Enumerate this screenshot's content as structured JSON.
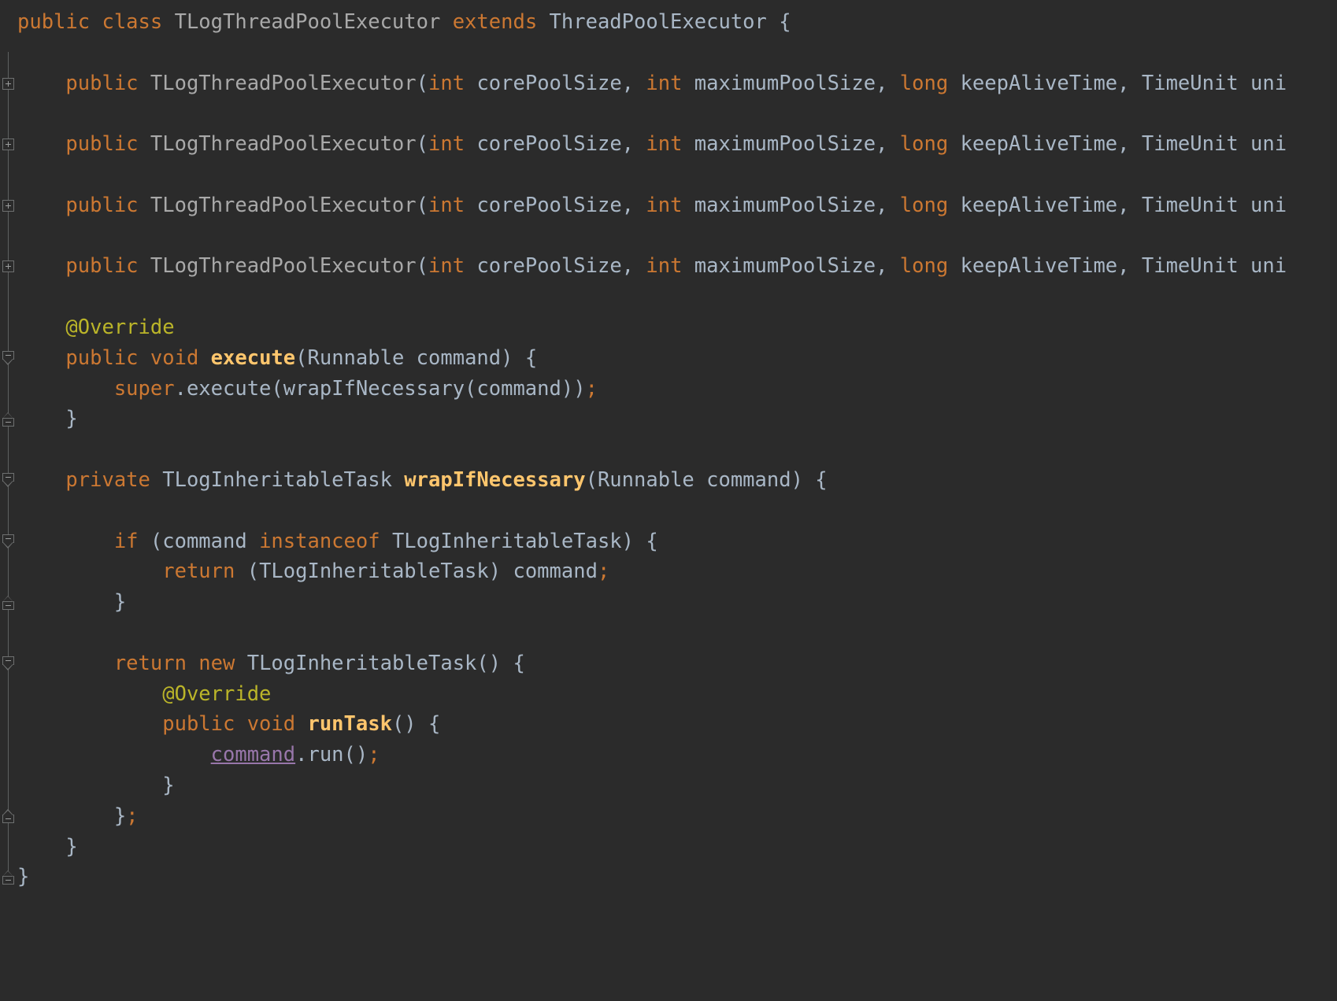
{
  "editor": {
    "language": "Java",
    "theme": "Darcula",
    "background": "#2b2b2b",
    "font_size_px": 25.5,
    "line_height_px": 38.8,
    "colors": {
      "keyword": "#cc7832",
      "class_declaration_name": "#a9a9a9",
      "type_reference": "#a9b7c6",
      "method_name": "#ffc66d",
      "annotation": "#bbb529",
      "identifier": "#a9b7c6",
      "captured_variable": "#9876aa",
      "gutter_line": "#5e6060",
      "fold_marker_border": "#6e7070"
    }
  },
  "gutter": {
    "markers": [
      {
        "type": "fold-collapsed-plus",
        "icon": "plus-box-icon",
        "line": 3
      },
      {
        "type": "fold-collapsed-plus",
        "icon": "plus-box-icon",
        "line": 5
      },
      {
        "type": "fold-collapsed-plus",
        "icon": "plus-box-icon",
        "line": 7
      },
      {
        "type": "fold-collapsed-plus",
        "icon": "plus-box-icon",
        "line": 9
      },
      {
        "type": "fold-region-start",
        "icon": "minus-pentagon-down-icon",
        "line": 12
      },
      {
        "type": "fold-region-end",
        "icon": "minus-pentagon-up-icon",
        "line": 14
      },
      {
        "type": "fold-region-start",
        "icon": "minus-pentagon-down-icon",
        "line": 16
      },
      {
        "type": "fold-region-start",
        "icon": "minus-pentagon-down-icon",
        "line": 18
      },
      {
        "type": "fold-region-end",
        "icon": "minus-pentagon-up-icon",
        "line": 20
      },
      {
        "type": "fold-region-start",
        "icon": "minus-pentagon-down-icon",
        "line": 22
      },
      {
        "type": "fold-region-end",
        "icon": "minus-pentagon-up-icon",
        "line": 27
      },
      {
        "type": "fold-region-end",
        "icon": "minus-pentagon-up-icon",
        "line": 29
      }
    ]
  },
  "code": {
    "lines": [
      {
        "n": 1,
        "tokens": [
          {
            "t": "public ",
            "c": "kw"
          },
          {
            "t": "class ",
            "c": "kw"
          },
          {
            "t": "TLogThreadPoolExecutor ",
            "c": "decl"
          },
          {
            "t": "extends ",
            "c": "kw"
          },
          {
            "t": "ThreadPoolExecutor",
            "c": "type"
          },
          {
            "t": " {",
            "c": "ident"
          }
        ]
      },
      {
        "n": 2,
        "tokens": []
      },
      {
        "n": 3,
        "tokens": [
          {
            "t": "    ",
            "c": "ident"
          },
          {
            "t": "public ",
            "c": "kw"
          },
          {
            "t": "TLogThreadPoolExecutor",
            "c": "decl"
          },
          {
            "t": "(",
            "c": "ident"
          },
          {
            "t": "int ",
            "c": "kw"
          },
          {
            "t": "corePoolSize, ",
            "c": "ident"
          },
          {
            "t": "int ",
            "c": "kw"
          },
          {
            "t": "maximumPoolSize, ",
            "c": "ident"
          },
          {
            "t": "long ",
            "c": "kw"
          },
          {
            "t": "keepAliveTime, ",
            "c": "ident"
          },
          {
            "t": "TimeUnit ",
            "c": "type"
          },
          {
            "t": "uni",
            "c": "ident"
          }
        ]
      },
      {
        "n": 4,
        "tokens": []
      },
      {
        "n": 5,
        "tokens": [
          {
            "t": "    ",
            "c": "ident"
          },
          {
            "t": "public ",
            "c": "kw"
          },
          {
            "t": "TLogThreadPoolExecutor",
            "c": "decl"
          },
          {
            "t": "(",
            "c": "ident"
          },
          {
            "t": "int ",
            "c": "kw"
          },
          {
            "t": "corePoolSize, ",
            "c": "ident"
          },
          {
            "t": "int ",
            "c": "kw"
          },
          {
            "t": "maximumPoolSize, ",
            "c": "ident"
          },
          {
            "t": "long ",
            "c": "kw"
          },
          {
            "t": "keepAliveTime, ",
            "c": "ident"
          },
          {
            "t": "TimeUnit ",
            "c": "type"
          },
          {
            "t": "uni",
            "c": "ident"
          }
        ]
      },
      {
        "n": 6,
        "tokens": []
      },
      {
        "n": 7,
        "tokens": [
          {
            "t": "    ",
            "c": "ident"
          },
          {
            "t": "public ",
            "c": "kw"
          },
          {
            "t": "TLogThreadPoolExecutor",
            "c": "decl"
          },
          {
            "t": "(",
            "c": "ident"
          },
          {
            "t": "int ",
            "c": "kw"
          },
          {
            "t": "corePoolSize, ",
            "c": "ident"
          },
          {
            "t": "int ",
            "c": "kw"
          },
          {
            "t": "maximumPoolSize, ",
            "c": "ident"
          },
          {
            "t": "long ",
            "c": "kw"
          },
          {
            "t": "keepAliveTime, ",
            "c": "ident"
          },
          {
            "t": "TimeUnit ",
            "c": "type"
          },
          {
            "t": "uni",
            "c": "ident"
          }
        ]
      },
      {
        "n": 8,
        "tokens": []
      },
      {
        "n": 9,
        "tokens": [
          {
            "t": "    ",
            "c": "ident"
          },
          {
            "t": "public ",
            "c": "kw"
          },
          {
            "t": "TLogThreadPoolExecutor",
            "c": "decl"
          },
          {
            "t": "(",
            "c": "ident"
          },
          {
            "t": "int ",
            "c": "kw"
          },
          {
            "t": "corePoolSize, ",
            "c": "ident"
          },
          {
            "t": "int ",
            "c": "kw"
          },
          {
            "t": "maximumPoolSize, ",
            "c": "ident"
          },
          {
            "t": "long ",
            "c": "kw"
          },
          {
            "t": "keepAliveTime, ",
            "c": "ident"
          },
          {
            "t": "TimeUnit ",
            "c": "type"
          },
          {
            "t": "uni",
            "c": "ident"
          }
        ]
      },
      {
        "n": 10,
        "tokens": []
      },
      {
        "n": 11,
        "tokens": [
          {
            "t": "    ",
            "c": "ident"
          },
          {
            "t": "@Override",
            "c": "anno"
          }
        ]
      },
      {
        "n": 12,
        "tokens": [
          {
            "t": "    ",
            "c": "ident"
          },
          {
            "t": "public ",
            "c": "kw"
          },
          {
            "t": "void ",
            "c": "kw"
          },
          {
            "t": "execute",
            "c": "meth"
          },
          {
            "t": "(",
            "c": "ident"
          },
          {
            "t": "Runnable ",
            "c": "type"
          },
          {
            "t": "command) {",
            "c": "ident"
          }
        ]
      },
      {
        "n": 13,
        "tokens": [
          {
            "t": "        ",
            "c": "ident"
          },
          {
            "t": "super",
            "c": "kw"
          },
          {
            "t": ".execute(wrapIfNecessary(command))",
            "c": "ident"
          },
          {
            "t": ";",
            "c": "semi"
          }
        ]
      },
      {
        "n": 14,
        "tokens": [
          {
            "t": "    }",
            "c": "ident"
          }
        ]
      },
      {
        "n": 15,
        "tokens": []
      },
      {
        "n": 16,
        "tokens": [
          {
            "t": "    ",
            "c": "ident"
          },
          {
            "t": "private ",
            "c": "kw"
          },
          {
            "t": "TLogInheritableTask ",
            "c": "type"
          },
          {
            "t": "wrapIfNecessary",
            "c": "meth"
          },
          {
            "t": "(",
            "c": "ident"
          },
          {
            "t": "Runnable ",
            "c": "type"
          },
          {
            "t": "command) {",
            "c": "ident"
          }
        ]
      },
      {
        "n": 17,
        "tokens": []
      },
      {
        "n": 18,
        "tokens": [
          {
            "t": "        ",
            "c": "ident"
          },
          {
            "t": "if ",
            "c": "kw"
          },
          {
            "t": "(command ",
            "c": "ident"
          },
          {
            "t": "instanceof ",
            "c": "kw"
          },
          {
            "t": "TLogInheritableTask",
            "c": "type"
          },
          {
            "t": ") {",
            "c": "ident"
          }
        ]
      },
      {
        "n": 19,
        "tokens": [
          {
            "t": "            ",
            "c": "ident"
          },
          {
            "t": "return ",
            "c": "kw"
          },
          {
            "t": "(",
            "c": "ident"
          },
          {
            "t": "TLogInheritableTask",
            "c": "type"
          },
          {
            "t": ") command",
            "c": "ident"
          },
          {
            "t": ";",
            "c": "semi"
          }
        ]
      },
      {
        "n": 20,
        "tokens": [
          {
            "t": "        }",
            "c": "ident"
          }
        ]
      },
      {
        "n": 21,
        "tokens": []
      },
      {
        "n": 22,
        "tokens": [
          {
            "t": "        ",
            "c": "ident"
          },
          {
            "t": "return ",
            "c": "kw"
          },
          {
            "t": "new ",
            "c": "kw"
          },
          {
            "t": "TLogInheritableTask",
            "c": "type"
          },
          {
            "t": "() {",
            "c": "ident"
          }
        ]
      },
      {
        "n": 23,
        "tokens": [
          {
            "t": "            ",
            "c": "ident"
          },
          {
            "t": "@Override",
            "c": "anno"
          }
        ]
      },
      {
        "n": 24,
        "tokens": [
          {
            "t": "            ",
            "c": "ident"
          },
          {
            "t": "public ",
            "c": "kw"
          },
          {
            "t": "void ",
            "c": "kw"
          },
          {
            "t": "runTask",
            "c": "meth"
          },
          {
            "t": "() {",
            "c": "ident"
          }
        ]
      },
      {
        "n": 25,
        "tokens": [
          {
            "t": "                ",
            "c": "ident"
          },
          {
            "t": "command",
            "c": "capt"
          },
          {
            "t": ".run()",
            "c": "ident"
          },
          {
            "t": ";",
            "c": "semi"
          }
        ]
      },
      {
        "n": 26,
        "tokens": [
          {
            "t": "            }",
            "c": "ident"
          }
        ]
      },
      {
        "n": 27,
        "tokens": [
          {
            "t": "        }",
            "c": "ident"
          },
          {
            "t": ";",
            "c": "semi"
          }
        ]
      },
      {
        "n": 28,
        "tokens": [
          {
            "t": "    }",
            "c": "ident"
          }
        ]
      },
      {
        "n": 29,
        "tokens": [
          {
            "t": "}",
            "c": "ident"
          }
        ]
      }
    ]
  }
}
